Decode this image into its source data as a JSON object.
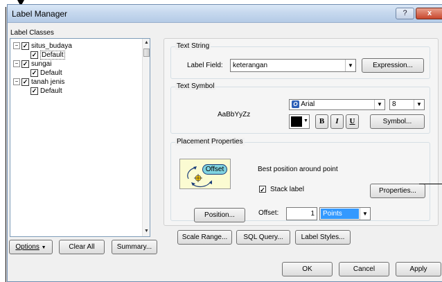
{
  "window": {
    "title": "Label Manager",
    "help_glyph": "?",
    "close_glyph": "x"
  },
  "label_classes": {
    "heading": "Label Classes",
    "tree": [
      {
        "label": "situs_budaya",
        "level": 0
      },
      {
        "label": "Default",
        "level": 1,
        "selected": true
      },
      {
        "label": "sungai",
        "level": 0
      },
      {
        "label": "Default",
        "level": 1
      },
      {
        "label": "tanah jenis",
        "level": 0
      },
      {
        "label": "Default",
        "level": 1
      }
    ],
    "options_button": "Options",
    "clear_all_button": "Clear All",
    "summary_button": "Summary..."
  },
  "text_string": {
    "title": "Text String",
    "label_field_label": "Label Field:",
    "label_field_value": "keterangan",
    "expression_button": "Expression..."
  },
  "text_symbol": {
    "title": "Text Symbol",
    "preview": "AaBbYyZz",
    "font_value": "Arial",
    "size_value": "8",
    "bold": "B",
    "italic": "I",
    "underline": "U",
    "symbol_button": "Symbol..."
  },
  "placement": {
    "title": "Placement Properties",
    "image_label": "Offset",
    "description": "Best position around point",
    "stack_label": "Stack label",
    "stack_checked": true,
    "properties_button": "Properties...",
    "position_button": "Position...",
    "offset_label": "Offset:",
    "offset_value": "1",
    "offset_unit": "Points"
  },
  "bottom_buttons": {
    "scale_range": "Scale Range...",
    "sql_query": "SQL Query...",
    "label_styles": "Label Styles..."
  },
  "dialog_buttons": {
    "ok": "OK",
    "cancel": "Cancel",
    "apply": "Apply"
  },
  "colors": {
    "accent": "#3399ff",
    "text_color_swatch": "#000000",
    "title_bar": "#c6d8ee"
  }
}
